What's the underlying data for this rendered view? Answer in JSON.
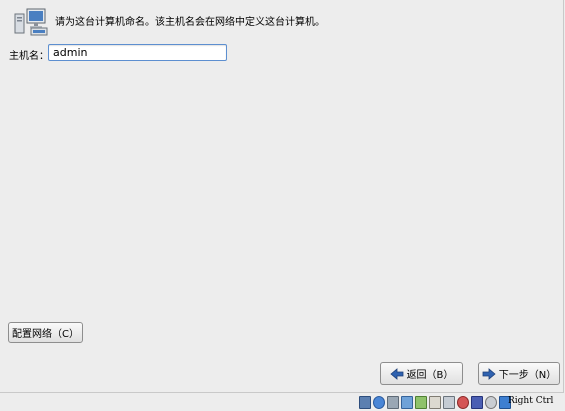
{
  "header": {
    "icon": "network-computers-icon",
    "text": "请为这台计算机命名。该主机名会在网络中定义这台计算机。"
  },
  "hostname": {
    "label": "主机名：",
    "value": "admin"
  },
  "buttons": {
    "configure_network": "配置网络（C）",
    "back": "返回（B）",
    "next": "下一步（N）"
  },
  "statusbar": {
    "icons": [
      "hard-disk-icon",
      "optical-drive-icon",
      "audio-icon",
      "usb-icon",
      "network-icon",
      "shared-folder-icon",
      "display-icon",
      "video-capture-icon",
      "virtualization-icon",
      "mouse-integration-icon",
      "arrow-down-icon"
    ],
    "host_key": "Right Ctrl"
  },
  "colors": {
    "accent": "#3a6fb8",
    "background": "#ededed"
  }
}
